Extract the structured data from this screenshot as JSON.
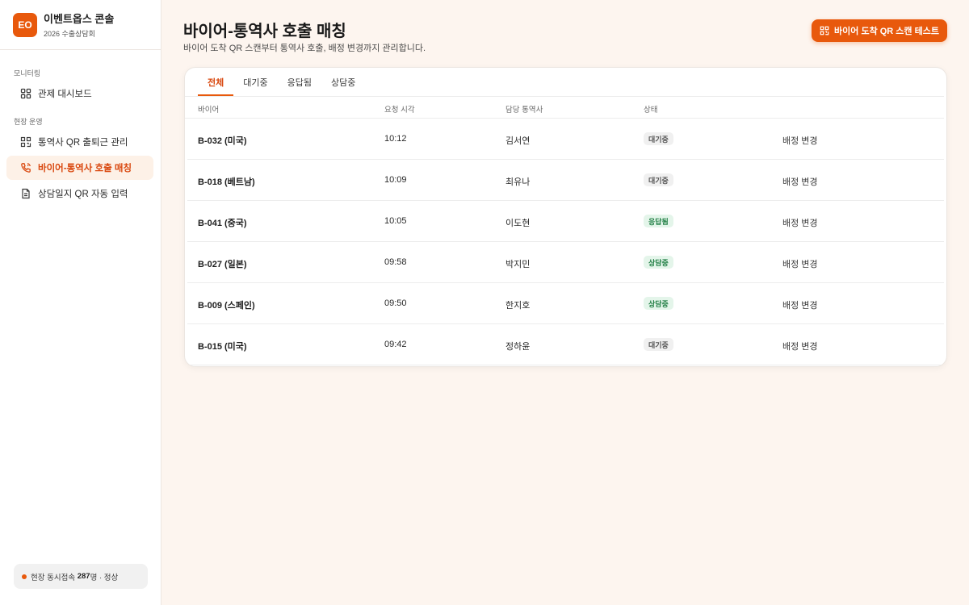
{
  "brand": {
    "logo_text": "EO",
    "name": "이벤트옵스 콘솔",
    "subtitle": "2026 수출상담회"
  },
  "sidebar": {
    "sections": [
      {
        "label": "모니터링",
        "items": [
          {
            "label": "관제 대시보드",
            "icon": "dashboard-icon"
          }
        ]
      },
      {
        "label": "현장 운영",
        "items": [
          {
            "label": "통역사 QR 출퇴근 관리",
            "icon": "qr-icon"
          },
          {
            "label": "바이어-통역사 호출 매칭",
            "icon": "phone-icon",
            "active": true
          },
          {
            "label": "상담일지 QR 자동 입력",
            "icon": "document-icon"
          }
        ]
      }
    ],
    "status": {
      "prefix": "현장 동시접속",
      "count": "287",
      "suffix": "명 · 정상"
    }
  },
  "header": {
    "title": "바이어-통역사 호출 매칭",
    "description": "바이어 도착 QR 스캔부터 통역사 호출, 배정 변경까지 관리합니다.",
    "action_label": "바이어 도착 QR 스캔 테스트"
  },
  "tabs": [
    {
      "label": "전체",
      "active": true
    },
    {
      "label": "대기중"
    },
    {
      "label": "응답됨"
    },
    {
      "label": "상담중"
    }
  ],
  "table": {
    "columns": [
      "바이어",
      "요청 시각",
      "담당 통역사",
      "상태"
    ],
    "rows": [
      {
        "buyer": "B-032 (미국)",
        "time": "10:12",
        "interpreter": "김서연",
        "status": "대기중",
        "status_type": "wait",
        "action": "배정 변경"
      },
      {
        "buyer": "B-018 (베트남)",
        "time": "10:09",
        "interpreter": "최유나",
        "status": "대기중",
        "status_type": "wait",
        "action": "배정 변경"
      },
      {
        "buyer": "B-041 (중국)",
        "time": "10:05",
        "interpreter": "이도현",
        "status": "응답됨",
        "status_type": "ok",
        "action": "배정 변경"
      },
      {
        "buyer": "B-027 (일본)",
        "time": "09:58",
        "interpreter": "박지민",
        "status": "상담중",
        "status_type": "ok",
        "action": "배정 변경"
      },
      {
        "buyer": "B-009 (스페인)",
        "time": "09:50",
        "interpreter": "한지호",
        "status": "상담중",
        "status_type": "ok",
        "action": "배정 변경"
      },
      {
        "buyer": "B-015 (미국)",
        "time": "09:42",
        "interpreter": "정하윤",
        "status": "대기중",
        "status_type": "wait",
        "action": "배정 변경"
      }
    ]
  },
  "colors": {
    "accent": "#e8590c",
    "background": "#fdf5ef",
    "badge_ok_bg": "#e4f5ea",
    "badge_wait_bg": "#f0f0f0"
  }
}
